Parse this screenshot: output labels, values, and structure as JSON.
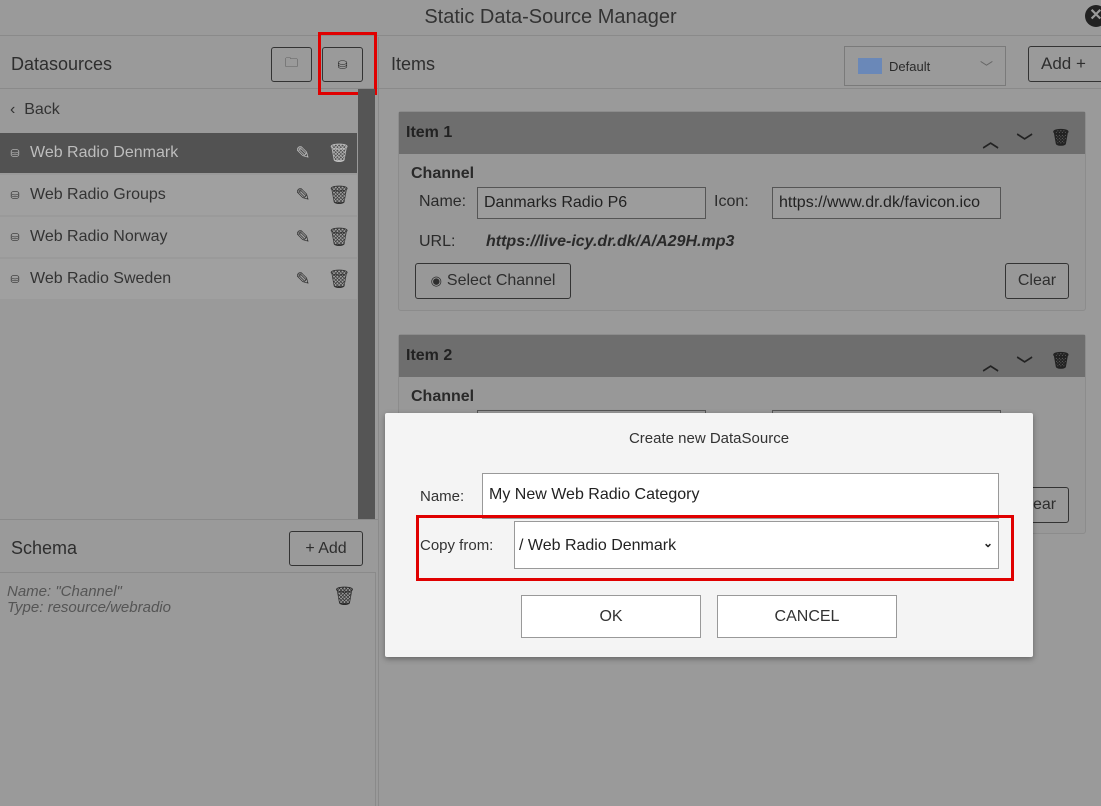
{
  "window": {
    "title": "Static Data-Source Manager",
    "close_icon": "close-icon"
  },
  "datasources": {
    "header": "Datasources",
    "back_label": "Back",
    "items": [
      {
        "label": "Web Radio Denmark",
        "selected": true
      },
      {
        "label": "Web Radio Groups"
      },
      {
        "label": "Web Radio Norway"
      },
      {
        "label": "Web Radio Sweden"
      }
    ]
  },
  "schema": {
    "header": "Schema",
    "add_label": "+ Add",
    "entry_name": "Name: \"Channel\"",
    "entry_type": "Type: resource/webradio"
  },
  "items_panel": {
    "header": "Items",
    "language_select": "Default",
    "add_label": "Add +",
    "cards": [
      {
        "title": "Item 1",
        "section": "Channel",
        "name_label": "Name:",
        "name_value": "Danmarks Radio P6",
        "icon_label": "Icon:",
        "icon_value": "https://www.dr.dk/favicon.ico",
        "url_label": "URL:",
        "url_value": "https://live-icy.dr.dk/A/A29H.mp3",
        "select_label": "Select Channel",
        "clear_label": "Clear"
      },
      {
        "title": "Item 2",
        "section": "Channel",
        "clear_label": "Clear"
      }
    ]
  },
  "dialog": {
    "title": "Create new DataSource",
    "name_label": "Name:",
    "name_value": "My New Web Radio Category",
    "copy_label": "Copy from:",
    "copy_value": "/ Web Radio Denmark",
    "ok_label": "OK",
    "cancel_label": "CANCEL"
  },
  "colors": {
    "highlight": "#e00000",
    "selected_row": "#525252"
  }
}
